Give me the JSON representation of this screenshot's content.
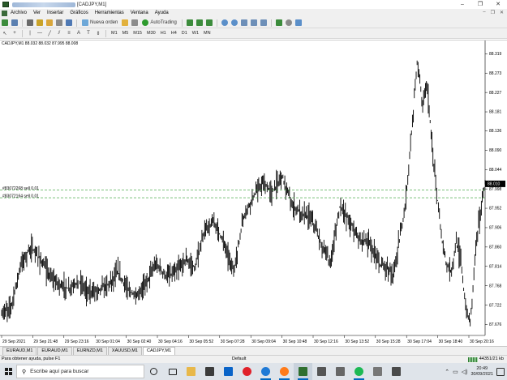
{
  "window": {
    "title": "[CADJPY,M1]",
    "controls": [
      "–",
      "❐",
      "✕"
    ],
    "mdi_controls": [
      "–",
      "❐",
      "✕"
    ]
  },
  "menu": {
    "items": [
      "Archivo",
      "Ver",
      "Insertar",
      "Gráficos",
      "Herramientas",
      "Ventana",
      "Ayuda"
    ]
  },
  "toolbar": {
    "new_order_label": "Nueva orden",
    "autotrading_label": "AutoTrading",
    "timeframes": [
      "M1",
      "M5",
      "M15",
      "M30",
      "H1",
      "H4",
      "D1",
      "W1",
      "MN"
    ],
    "active_timeframe": "M1"
  },
  "chart": {
    "header": "CADJPY,M1  88.032 88.032 87.995 88.008",
    "current_price_label": "88.010",
    "order_lines": [
      {
        "label": "#83072268 sell 0.01",
        "price": 87.995
      },
      {
        "label": "#83072164 sell 0.01",
        "price": 87.977
      }
    ],
    "colors": {
      "candles": "#000000",
      "order_line": "#2e9b2e",
      "price_tag": "#000000"
    }
  },
  "chart_data": {
    "type": "line",
    "title": "CADJPY,M1",
    "price_ticks": [
      "88.319",
      "88.273",
      "88.227",
      "88.181",
      "88.136",
      "88.090",
      "88.044",
      "87.998",
      "87.952",
      "87.906",
      "87.860",
      "87.814",
      "87.768",
      "87.722",
      "87.676"
    ],
    "time_ticks": [
      "29 Sep 2021",
      "29 Sep 21:48",
      "29 Sep 23:16",
      "30 Sep 01:04",
      "30 Sep 02:40",
      "30 Sep 04:16",
      "30 Sep 05:52",
      "30 Sep 07:28",
      "30 Sep 09:04",
      "30 Sep 10:48",
      "30 Sep 12:16",
      "30 Sep 13:52",
      "30 Sep 15:28",
      "30 Sep 17:04",
      "30 Sep 18:40",
      "30 Sep 20:16"
    ],
    "ylim": [
      87.65,
      88.335
    ],
    "x": [
      0,
      0.02,
      0.04,
      0.06,
      0.08,
      0.1,
      0.12,
      0.14,
      0.16,
      0.18,
      0.2,
      0.22,
      0.24,
      0.26,
      0.28,
      0.3,
      0.32,
      0.34,
      0.36,
      0.38,
      0.4,
      0.42,
      0.44,
      0.46,
      0.48,
      0.5,
      0.52,
      0.54,
      0.56,
      0.58,
      0.6,
      0.62,
      0.64,
      0.66,
      0.68,
      0.7,
      0.72,
      0.74,
      0.76,
      0.78,
      0.8,
      0.81,
      0.82,
      0.83,
      0.84,
      0.85,
      0.86,
      0.87,
      0.88,
      0.89,
      0.9,
      0.91,
      0.92,
      0.93,
      0.94,
      0.95,
      0.96,
      0.97,
      0.98,
      0.99,
      1.0
    ],
    "series": [
      {
        "values": [
          87.7,
          87.72,
          87.82,
          87.86,
          87.83,
          87.79,
          87.77,
          87.76,
          87.78,
          87.75,
          87.76,
          87.77,
          87.8,
          87.76,
          87.74,
          87.78,
          87.82,
          87.79,
          87.8,
          87.83,
          87.81,
          87.9,
          87.92,
          87.87,
          87.8,
          87.93,
          87.98,
          88.01,
          87.99,
          88.03,
          87.96,
          87.94,
          87.93,
          87.87,
          87.82,
          87.96,
          87.92,
          87.88,
          87.87,
          87.82,
          87.81,
          87.79,
          87.86,
          87.92,
          88.02,
          88.16,
          88.31,
          88.2,
          88.25,
          88.1,
          87.99,
          87.88,
          87.82,
          87.8,
          87.87,
          87.83,
          87.71,
          87.68,
          87.86,
          87.94,
          88.01
        ]
      }
    ],
    "grid": false,
    "legend": "none"
  },
  "tabs": [
    "EURAUD,M1",
    "EURAUD,M1",
    "EURNZD,M1",
    "XAUUSD,M1",
    "CADJPY,M1"
  ],
  "active_tab": 4,
  "status": {
    "help": "Para obtener ayuda, pulse F1",
    "profile": "Default",
    "traffic": "44351/21 kb"
  },
  "taskbar": {
    "search_placeholder": "Escribe aquí para buscar",
    "time": "20:49",
    "date": "30/09/2021",
    "apps": [
      "cortana-icon",
      "task-view-icon",
      "file-explorer-icon",
      "store-icon",
      "mail-icon",
      "opera-icon",
      "edge-icon",
      "firefox-icon",
      "metatrader-icon",
      "app-icon",
      "app-icon",
      "spotify-icon",
      "app-icon",
      "app-icon"
    ]
  }
}
